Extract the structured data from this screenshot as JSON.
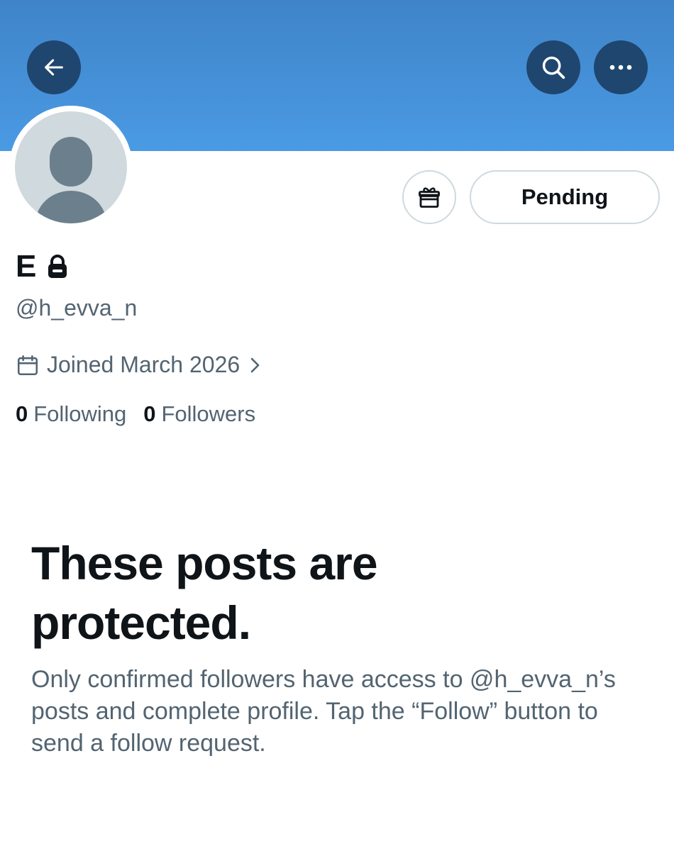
{
  "header": {
    "back_icon": "arrow-left-icon",
    "search_icon": "search-icon",
    "more_icon": "more-horizontal-icon",
    "banner_color": "#4a9ae4",
    "button_color": "#1f466e"
  },
  "profile": {
    "display_name": "E",
    "locked_icon": "lock-icon",
    "handle": "@h_evva_n",
    "joined": "Joined March 2026",
    "following_count": "0",
    "following_label": "Following",
    "followers_count": "0",
    "followers_label": "Followers"
  },
  "actions": {
    "gift_icon": "gift-icon",
    "pending_label": "Pending"
  },
  "protected": {
    "title": "These posts are protected.",
    "description": "Only confirmed followers have access to @h_evva_n’s posts and complete profile. Tap the “Follow” button to send a follow request."
  }
}
